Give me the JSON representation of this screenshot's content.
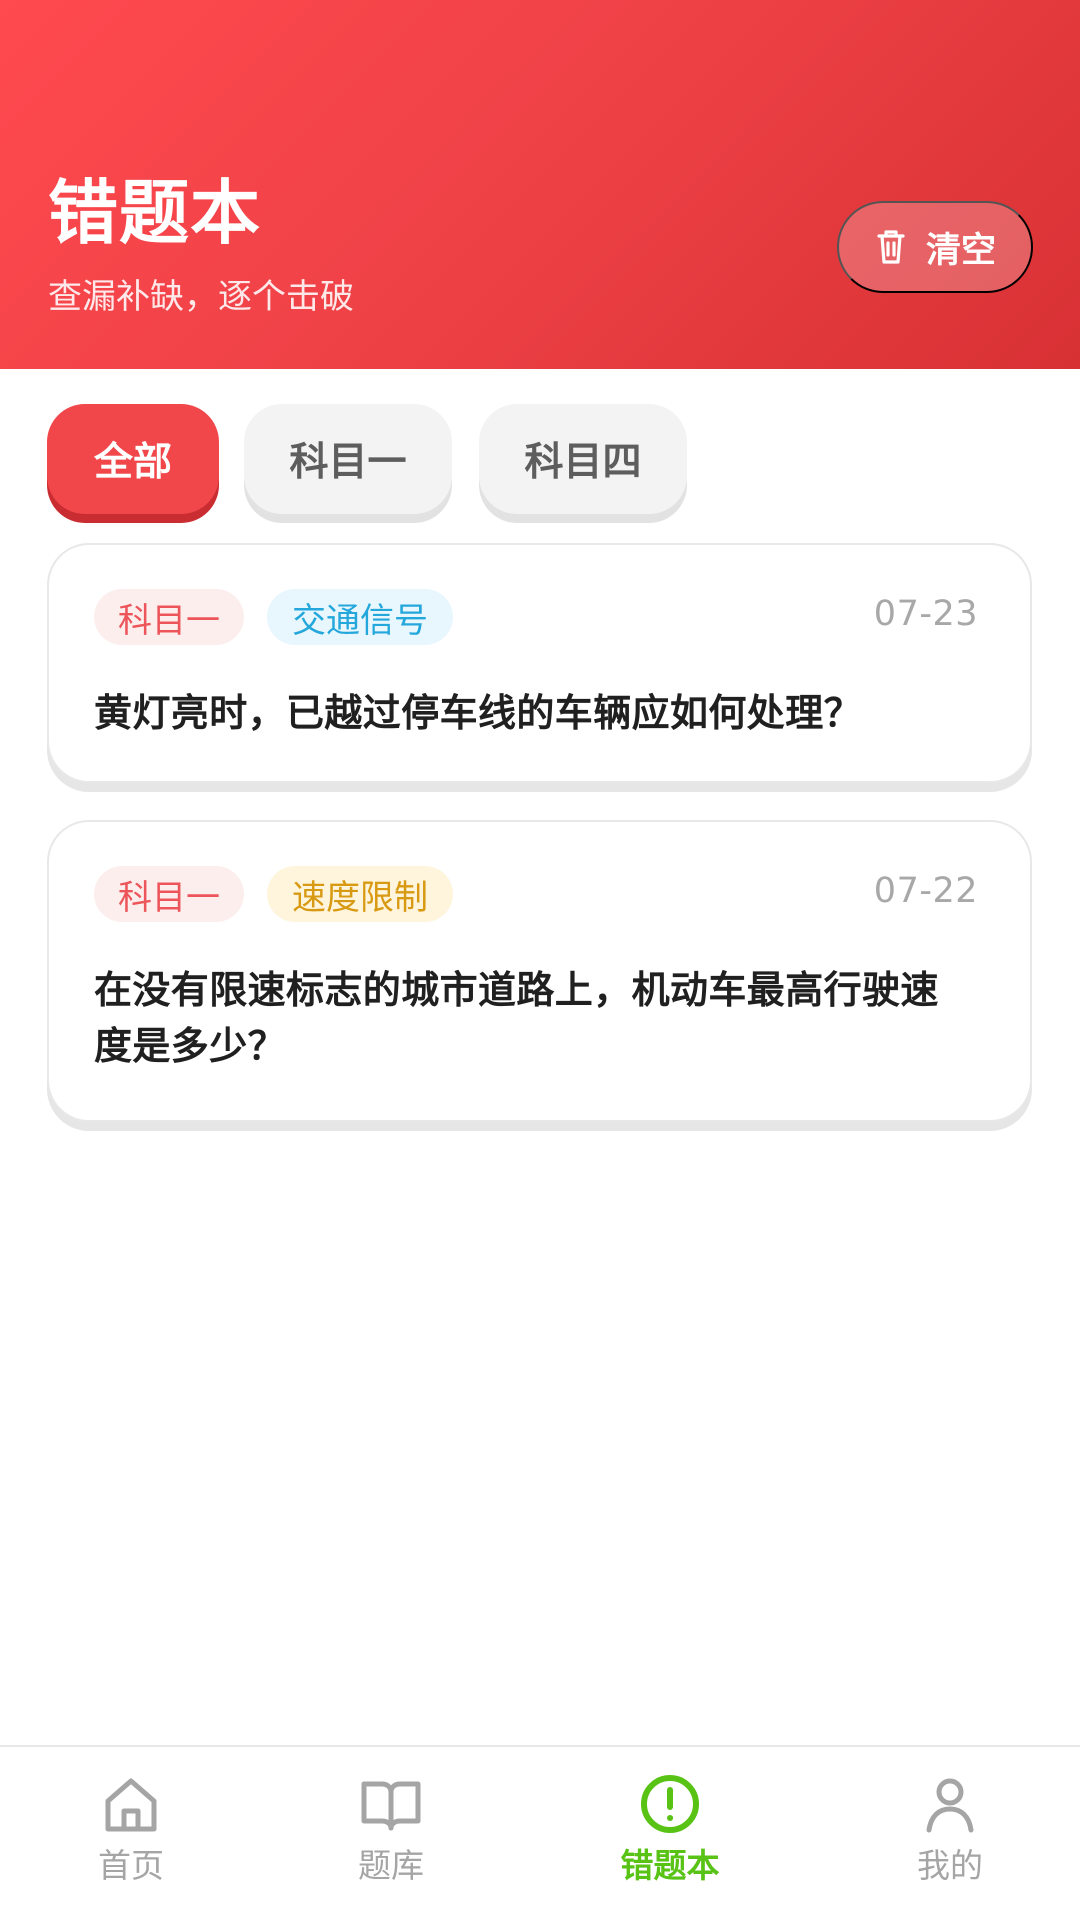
{
  "header": {
    "title": "错题本",
    "subtitle": "查漏补缺，逐个击破",
    "clear_label": "清空"
  },
  "filters": [
    {
      "label": "全部",
      "active": true
    },
    {
      "label": "科目一",
      "active": false
    },
    {
      "label": "科目四",
      "active": false
    }
  ],
  "questions": [
    {
      "subject": "科目一",
      "topic": "交通信号",
      "date": "07-23",
      "text": "黄灯亮时，已越过停车线的车辆应如何处理？"
    },
    {
      "subject": "科目一",
      "topic": "速度限制",
      "date": "07-22",
      "text": "在没有限速标志的城市道路上，机动车最高行驶速度是多少？"
    }
  ],
  "bottom_nav": [
    {
      "label": "首页",
      "icon": "home-icon"
    },
    {
      "label": "题库",
      "icon": "book-icon"
    },
    {
      "label": "错题本",
      "icon": "alert-circle-icon",
      "active": true
    },
    {
      "label": "我的",
      "icon": "user-icon"
    }
  ],
  "colors": {
    "header_red": "#ef4247",
    "active_nav_green": "#58c215",
    "blue_tag": "#24a7db",
    "yellow_tag": "#d99a13"
  }
}
